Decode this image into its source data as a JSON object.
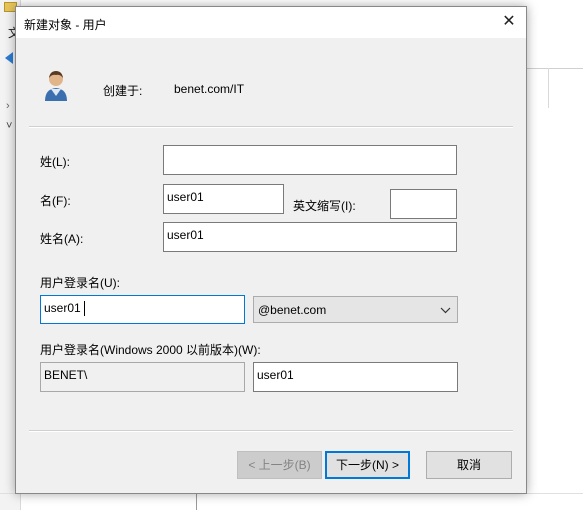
{
  "background": {
    "menu_letter": "文"
  },
  "dialog": {
    "title": "新建对象 - 用户",
    "close_glyph": "✕",
    "header": {
      "icon": "user-icon",
      "created_in_label": "创建于:",
      "created_in_value": "benet.com/IT"
    },
    "fields": {
      "last_name": {
        "label": "姓(L):",
        "value": ""
      },
      "first_name": {
        "label": "名(F):",
        "value": "user01"
      },
      "initials": {
        "label": "英文缩写(I):",
        "value": ""
      },
      "full_name": {
        "label": "姓名(A):",
        "value": "user01"
      },
      "logon_name": {
        "label": "用户登录名(U):",
        "value": "user01"
      },
      "upn_suffix": {
        "selected": "@benet.com",
        "chevron": "chevron-down-icon"
      },
      "pre2000_label": "用户登录名(Windows 2000 以前版本)(W):",
      "pre2000_domain": {
        "value": "BENET\\"
      },
      "pre2000_name": {
        "value": "user01"
      }
    },
    "buttons": {
      "back": "< 上一步(B)",
      "next": "下一步(N) >",
      "cancel": "取消"
    }
  },
  "colors": {
    "dialog_bg": "#f0f0f0",
    "focus_border": "#0078d7",
    "disabled_text": "#838383"
  }
}
